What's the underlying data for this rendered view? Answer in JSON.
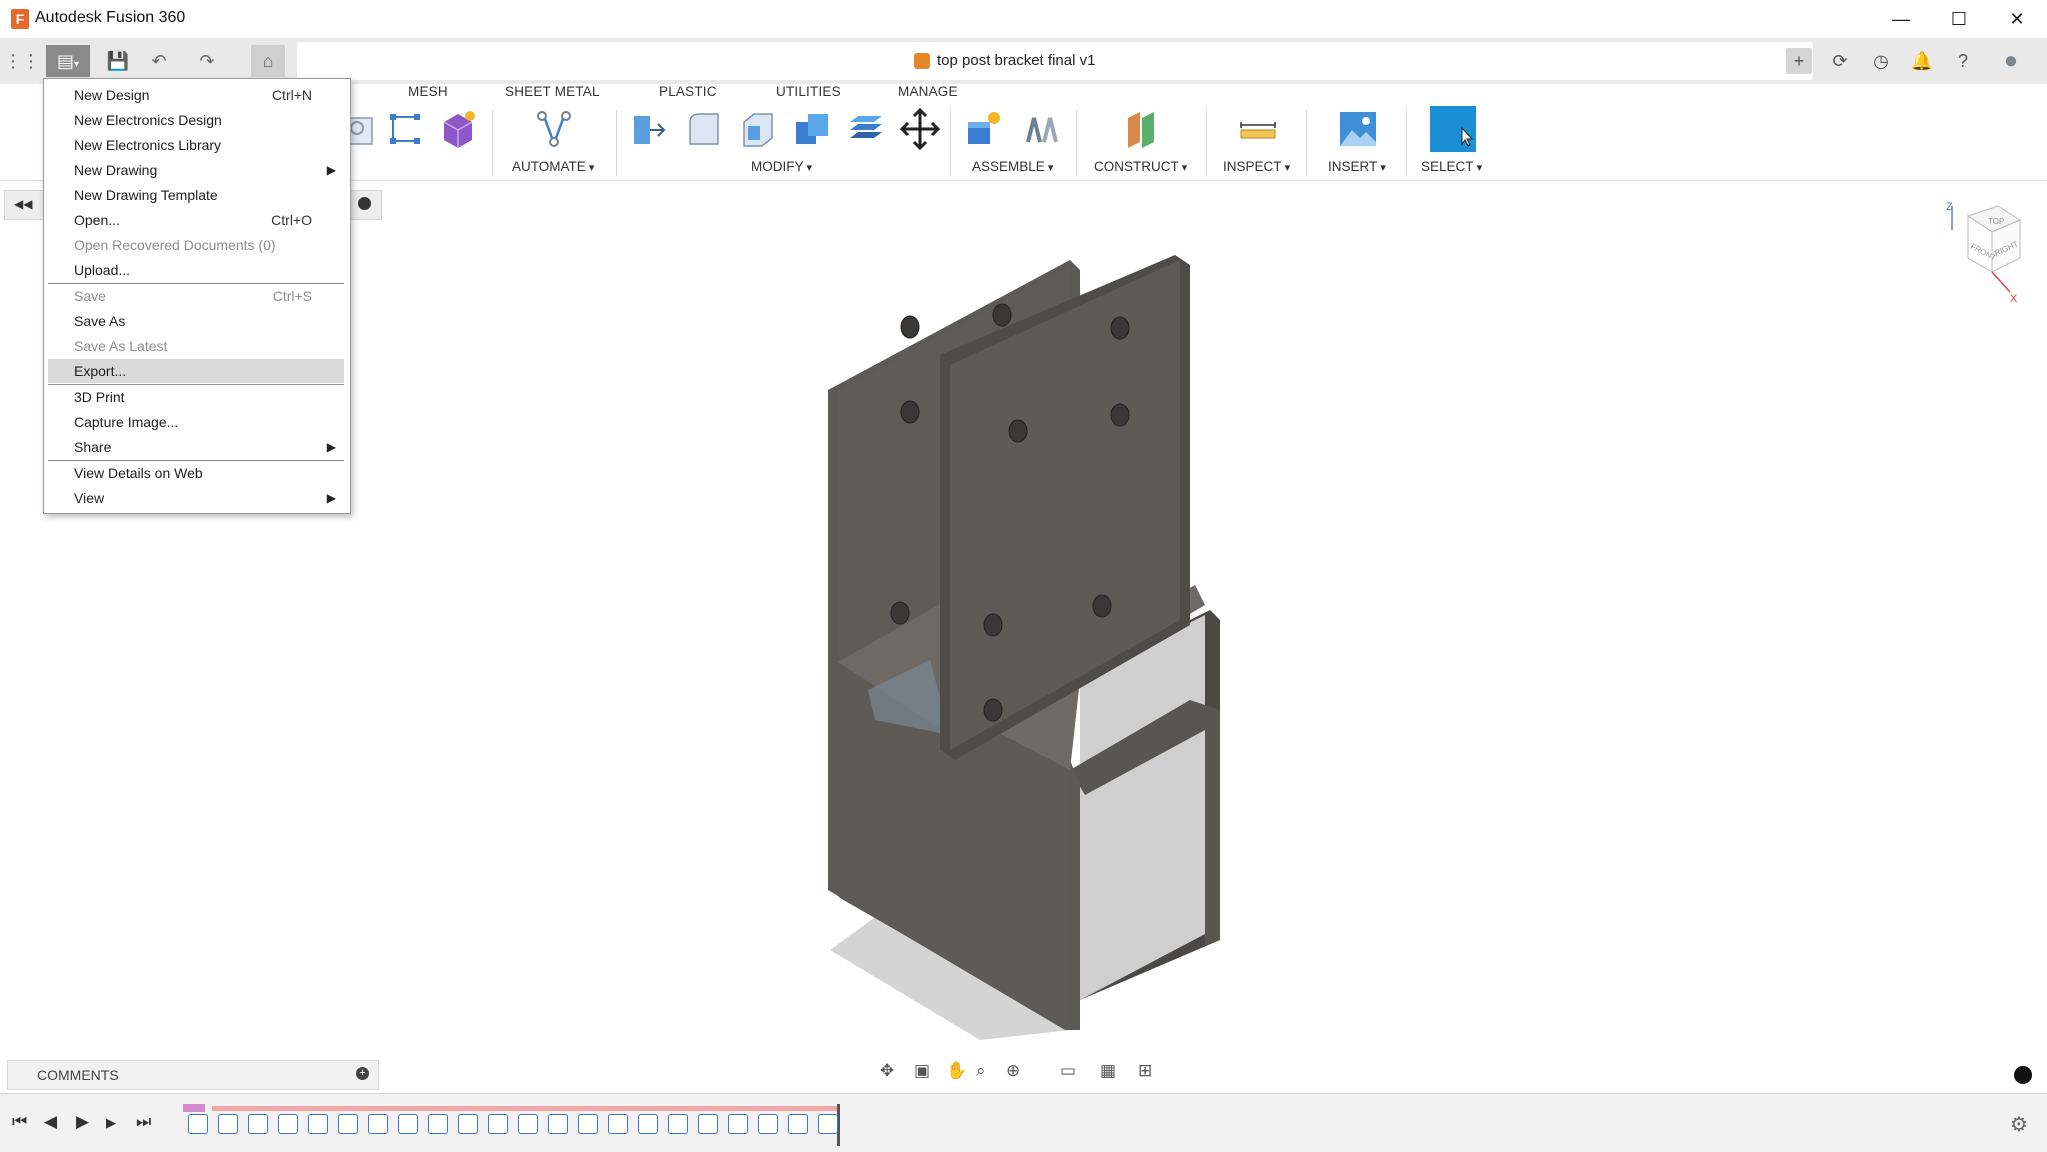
{
  "app": {
    "title": "Autodesk Fusion 360",
    "icon_letter": "F"
  },
  "window_controls": {
    "minimize": "—",
    "maximize": "☐",
    "close": "✕"
  },
  "document": {
    "name": "top post bracket final v1",
    "close_glyph": "✕"
  },
  "quick_access": {
    "grid_icon": "⋮⋮⋮",
    "file_icon": "▤",
    "save_icon": "💾",
    "undo_icon": "↶",
    "redo_icon": "↷",
    "home_icon": "⌂"
  },
  "right_tools": {
    "add": "+",
    "sync": "⟳",
    "history": "◷",
    "notifications": "🔔",
    "help": "?",
    "profile": "●"
  },
  "ribbon": {
    "tabs": [
      "MESH",
      "SHEET METAL",
      "PLASTIC",
      "UTILITIES",
      "MANAGE"
    ],
    "groups": [
      "AUTOMATE",
      "MODIFY",
      "ASSEMBLE",
      "CONSTRUCT",
      "INSPECT",
      "INSERT",
      "SELECT"
    ]
  },
  "file_menu": {
    "items": [
      {
        "label": "New Design",
        "shortcut": "Ctrl+N"
      },
      {
        "label": "New Electronics Design"
      },
      {
        "label": "New Electronics Library"
      },
      {
        "label": "New Drawing",
        "submenu": "▶"
      },
      {
        "label": "New Drawing Template"
      },
      {
        "label": "Open...",
        "shortcut": "Ctrl+O"
      },
      {
        "label": "Open Recovered Documents (0)",
        "disabled": true
      },
      {
        "label": "Upload..."
      },
      {
        "label": "Save",
        "shortcut": "Ctrl+S",
        "disabled": true
      },
      {
        "label": "Save As"
      },
      {
        "label": "Save As Latest",
        "disabled": true
      },
      {
        "label": "Export...",
        "highlighted": true
      },
      {
        "label": "3D Print"
      },
      {
        "label": "Capture Image..."
      },
      {
        "label": "Share",
        "submenu": "▶"
      },
      {
        "label": "View Details on Web"
      },
      {
        "label": "View",
        "submenu": "▶"
      }
    ]
  },
  "view_cube": {
    "top": "TOP",
    "front": "FRONT",
    "right": "RIGHT",
    "z": "Z",
    "x": "X"
  },
  "comments": {
    "label": "COMMENTS",
    "add": "+"
  },
  "timeline": {
    "first": "⏮",
    "prev": "◀",
    "play": "▶",
    "next": "▶",
    "last": "⏭",
    "settings": "⚙"
  },
  "colors": {
    "accent_select": "#1a8fd6",
    "part_body": "#5e5b56",
    "menu_highlight": "#d9d9d9"
  }
}
